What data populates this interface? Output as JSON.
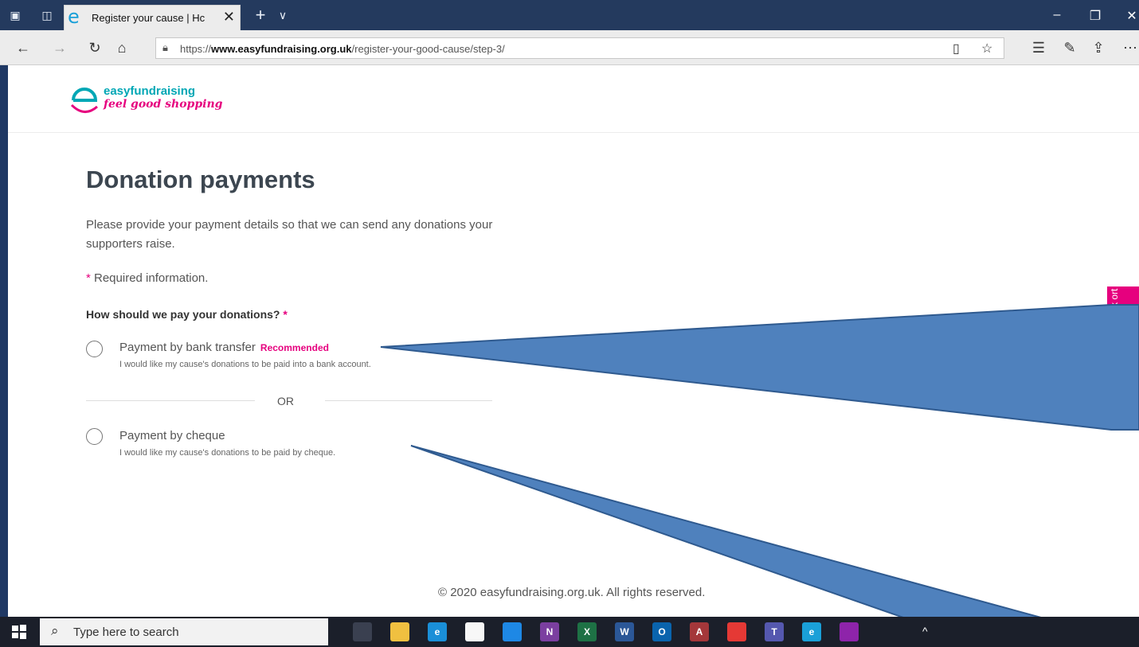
{
  "browser": {
    "tab_title": "Register your cause | Hc",
    "tab_close": "✕",
    "new_tab": "+",
    "tab_menu": "∨",
    "url_prefix": "https://",
    "url_domain": "www.easyfundraising.org.uk",
    "url_path": "/register-your-good-cause/step-3/",
    "icons": [
      "set-aside-tabs-icon",
      "tab-preview-icon",
      "edge-logo-icon",
      "back-icon",
      "forward-icon",
      "refresh-icon",
      "home-icon",
      "lock-icon",
      "reading-view-icon",
      "favorite-star-icon",
      "favorites-list-icon",
      "pen-icon",
      "share-icon",
      "more-icon",
      "minimize-icon",
      "restore-icon",
      "close-icon"
    ]
  },
  "site": {
    "logo_name": "easyfundraising",
    "logo_tagline": "feel good shopping",
    "brand_colors": {
      "teal": "#00a7b5",
      "pink": "#e6007e"
    }
  },
  "form": {
    "heading": "Donation payments",
    "intro": "Please provide your payment details so that we can send any donations your supporters raise.",
    "required_star": "*",
    "required_text": " Required information.",
    "question": "How should we pay your donations?",
    "question_star": " *",
    "options": [
      {
        "title": "Payment by bank transfer",
        "badge": "Recommended",
        "description": "I would like my cause's donations to be paid into a bank account."
      },
      {
        "title": "Payment by cheque",
        "badge": "",
        "description": "I would like my cause's donations to be paid by cheque."
      }
    ],
    "separator": "OR"
  },
  "feedback_label": "ck ort",
  "footer": {
    "copyright": "© 2020 easyfundraising.org.uk. All rights reserved."
  },
  "taskbar": {
    "search_placeholder": "Type here to search",
    "apps": [
      {
        "name": "task-view",
        "glyph": "",
        "color": "#3a4050"
      },
      {
        "name": "file-explorer",
        "glyph": "",
        "color": "#f0c040"
      },
      {
        "name": "edge",
        "glyph": "e",
        "color": "#1a8fd8"
      },
      {
        "name": "store",
        "glyph": "",
        "color": "#f7f7f7"
      },
      {
        "name": "mail",
        "glyph": "",
        "color": "#1e88e5"
      },
      {
        "name": "onenote",
        "glyph": "N",
        "color": "#7b3fa0"
      },
      {
        "name": "excel",
        "glyph": "X",
        "color": "#1e7145"
      },
      {
        "name": "word",
        "glyph": "W",
        "color": "#2b5797"
      },
      {
        "name": "outlook",
        "glyph": "O",
        "color": "#0a64ad"
      },
      {
        "name": "access",
        "glyph": "A",
        "color": "#a4373a"
      },
      {
        "name": "app-red",
        "glyph": "",
        "color": "#e53935"
      },
      {
        "name": "teams",
        "glyph": "T",
        "color": "#5558af"
      },
      {
        "name": "edge-new",
        "glyph": "e",
        "color": "#1aa0d8"
      },
      {
        "name": "app-drop",
        "glyph": "",
        "color": "#8e24aa"
      }
    ],
    "tray_chevron": "^"
  }
}
